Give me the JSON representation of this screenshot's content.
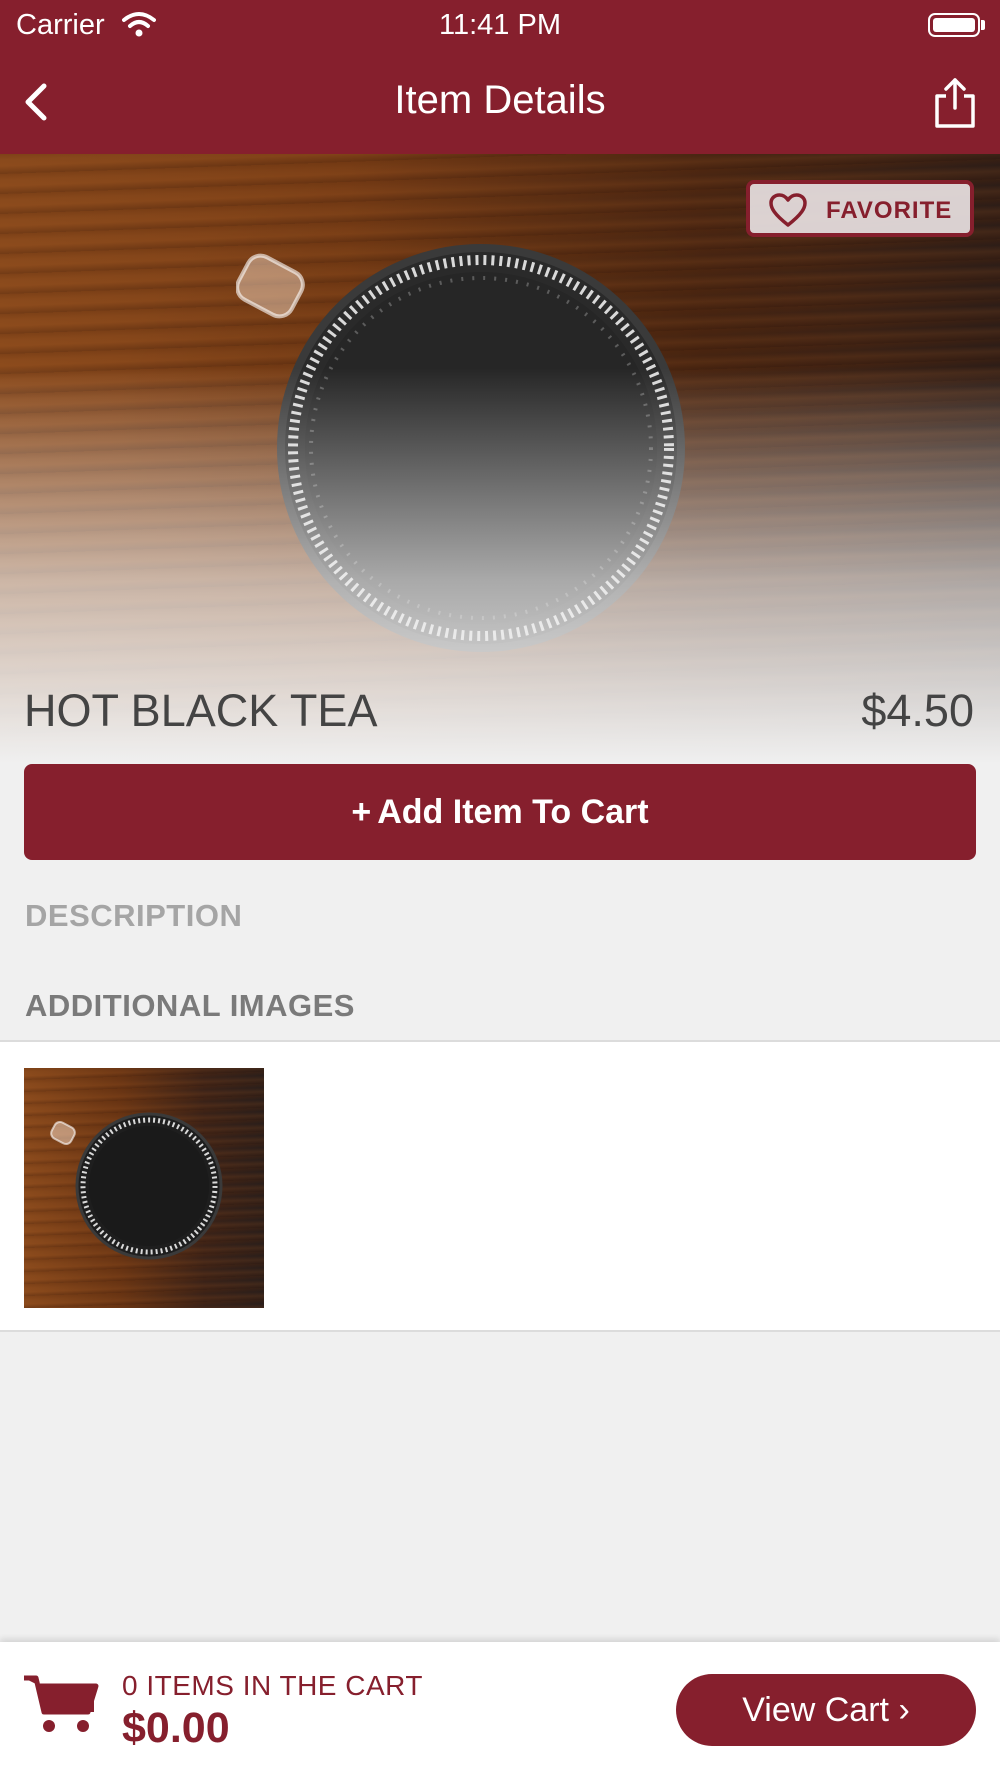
{
  "status_bar": {
    "carrier": "Carrier",
    "time": "11:41 PM"
  },
  "nav": {
    "title": "Item Details"
  },
  "favorite": {
    "label": "FAVORITE"
  },
  "item": {
    "name": "HOT BLACK TEA",
    "price": "$4.50"
  },
  "add_to_cart": {
    "plus": "+",
    "label": "Add Item To Cart"
  },
  "sections": {
    "description": "DESCRIPTION",
    "additional_images": "ADDITIONAL IMAGES"
  },
  "cart_bar": {
    "items_text": "0 ITEMS IN THE CART",
    "total": "$0.00",
    "view_cart_label": "View Cart",
    "view_cart_chevron": "›"
  },
  "colors": {
    "brand": "#861f2d",
    "background": "#f0f0f0"
  },
  "icons": [
    "wifi-icon",
    "battery-icon",
    "back-chevron-icon",
    "share-icon",
    "heart-icon",
    "cart-icon"
  ]
}
